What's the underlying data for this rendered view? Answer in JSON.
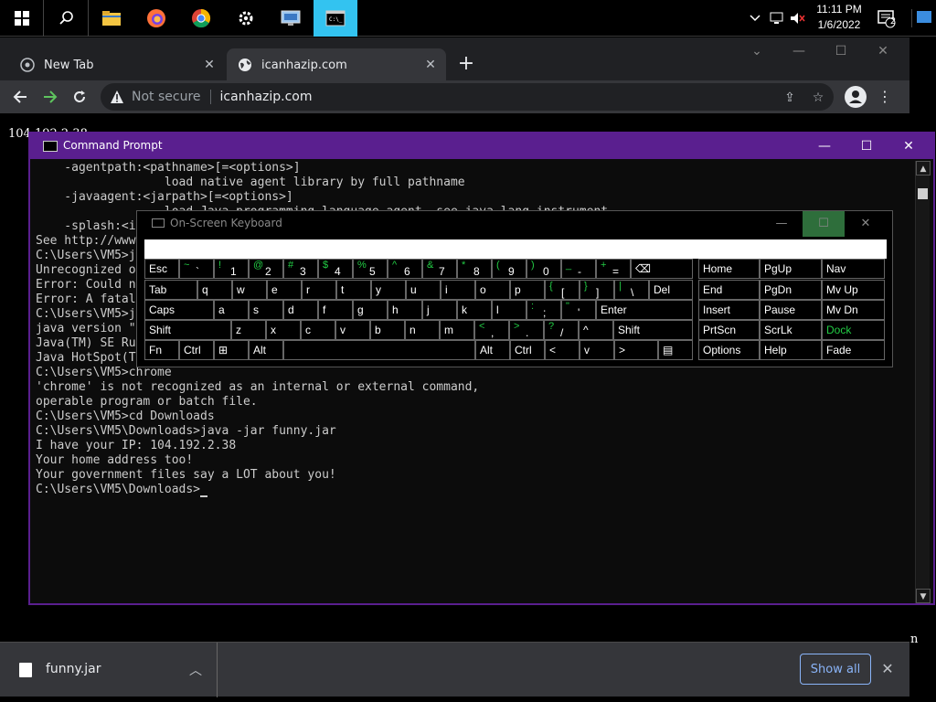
{
  "taskbar": {
    "clock_time": "11:11 PM",
    "clock_date": "1/6/2022",
    "notification_count": "2"
  },
  "browser": {
    "tabs": [
      {
        "label": "New Tab"
      },
      {
        "label": "icanhazip.com"
      }
    ],
    "address": {
      "security": "Not secure",
      "url": "icanhazip.com"
    },
    "page_text": "104.192.2.38",
    "page_partial_char": "n",
    "download": {
      "file_name": "funny.jar",
      "show_all_label": "Show all"
    }
  },
  "cmd": {
    "title": "Command Prompt",
    "lines": [
      "    -agentpath:<pathname>[=<options>]",
      "                  load native agent library by full pathname",
      "    -javaagent:<jarpath>[=<options>]",
      "                  load Java programming language agent, see java.lang.instrument",
      "    -splash:<i",
      "",
      "See http://www",
      "",
      "C:\\Users\\VM5>j",
      "Unrecognized o",
      "Error: Could n",
      "Error: A fatal",
      "",
      "C:\\Users\\VM5>j",
      "java version \"1.8.0_311\"",
      "Java(TM) SE Runtime Environment (build 1.8.0_311-b11)",
      "Java HotSpot(TM) 64-Bit Server VM (build 25.311-b11, mixed mode)",
      "",
      "C:\\Users\\VM5>chrome",
      "'chrome' is not recognized as an internal or external command,",
      "operable program or batch file.",
      "",
      "C:\\Users\\VM5>cd Downloads",
      "",
      "C:\\Users\\VM5\\Downloads>java -jar funny.jar",
      "I have your IP: 104.192.2.38",
      "Your home address too!",
      "Your government files say a LOT about you!",
      "",
      "C:\\Users\\VM5\\Downloads>"
    ]
  },
  "osk": {
    "title": "On-Screen Keyboard",
    "row1": [
      {
        "pri": "Esc"
      },
      {
        "sec": "~",
        "low": "`"
      },
      {
        "sec": "!",
        "low": "1"
      },
      {
        "sec": "@",
        "low": "2"
      },
      {
        "sec": "#",
        "low": "3"
      },
      {
        "sec": "$",
        "low": "4"
      },
      {
        "sec": "%",
        "low": "5"
      },
      {
        "sec": "^",
        "low": "6"
      },
      {
        "sec": "&",
        "low": "7"
      },
      {
        "sec": "*",
        "low": "8"
      },
      {
        "sec": "(",
        "low": "9"
      },
      {
        "sec": ")",
        "low": "0"
      },
      {
        "sec": "_",
        "low": "-"
      },
      {
        "sec": "+",
        "low": "="
      },
      {
        "pri": "⌫"
      }
    ],
    "row2": [
      {
        "pri": "Tab"
      },
      {
        "pri": "q"
      },
      {
        "pri": "w"
      },
      {
        "pri": "e"
      },
      {
        "pri": "r"
      },
      {
        "pri": "t"
      },
      {
        "pri": "y"
      },
      {
        "pri": "u"
      },
      {
        "pri": "i"
      },
      {
        "pri": "o"
      },
      {
        "pri": "p"
      },
      {
        "sec": "{",
        "low": "["
      },
      {
        "sec": "}",
        "low": "]"
      },
      {
        "sec": "|",
        "low": "\\"
      },
      {
        "pri": "Del"
      }
    ],
    "row3": [
      {
        "pri": "Caps"
      },
      {
        "pri": "a"
      },
      {
        "pri": "s"
      },
      {
        "pri": "d"
      },
      {
        "pri": "f"
      },
      {
        "pri": "g"
      },
      {
        "pri": "h"
      },
      {
        "pri": "j"
      },
      {
        "pri": "k"
      },
      {
        "pri": "l"
      },
      {
        "sec": ":",
        "low": ";"
      },
      {
        "sec": "\"",
        "low": "'"
      },
      {
        "pri": "Enter"
      }
    ],
    "row4": [
      {
        "pri": "Shift"
      },
      {
        "pri": "z"
      },
      {
        "pri": "x"
      },
      {
        "pri": "c"
      },
      {
        "pri": "v"
      },
      {
        "pri": "b"
      },
      {
        "pri": "n"
      },
      {
        "pri": "m"
      },
      {
        "sec": "<",
        "low": ","
      },
      {
        "sec": ">",
        "low": "."
      },
      {
        "sec": "?",
        "low": "/"
      },
      {
        "pri": "^"
      },
      {
        "pri": "Shift"
      }
    ],
    "row5": [
      {
        "pri": "Fn"
      },
      {
        "pri": "Ctrl"
      },
      {
        "pri": "⊞"
      },
      {
        "pri": "Alt"
      },
      {
        "pri": ""
      },
      {
        "pri": "Alt"
      },
      {
        "pri": "Ctrl"
      },
      {
        "pri": "<"
      },
      {
        "pri": "v"
      },
      {
        "pri": ">"
      },
      {
        "pri": "▤"
      }
    ],
    "nav": [
      [
        "Home",
        "PgUp",
        "Nav"
      ],
      [
        "End",
        "PgDn",
        "Mv Up"
      ],
      [
        "Insert",
        "Pause",
        "Mv Dn"
      ],
      [
        "PrtScn",
        "ScrLk",
        "Dock"
      ],
      [
        "Options",
        "Help",
        "Fade"
      ]
    ],
    "accent_color": "#22cc44"
  }
}
